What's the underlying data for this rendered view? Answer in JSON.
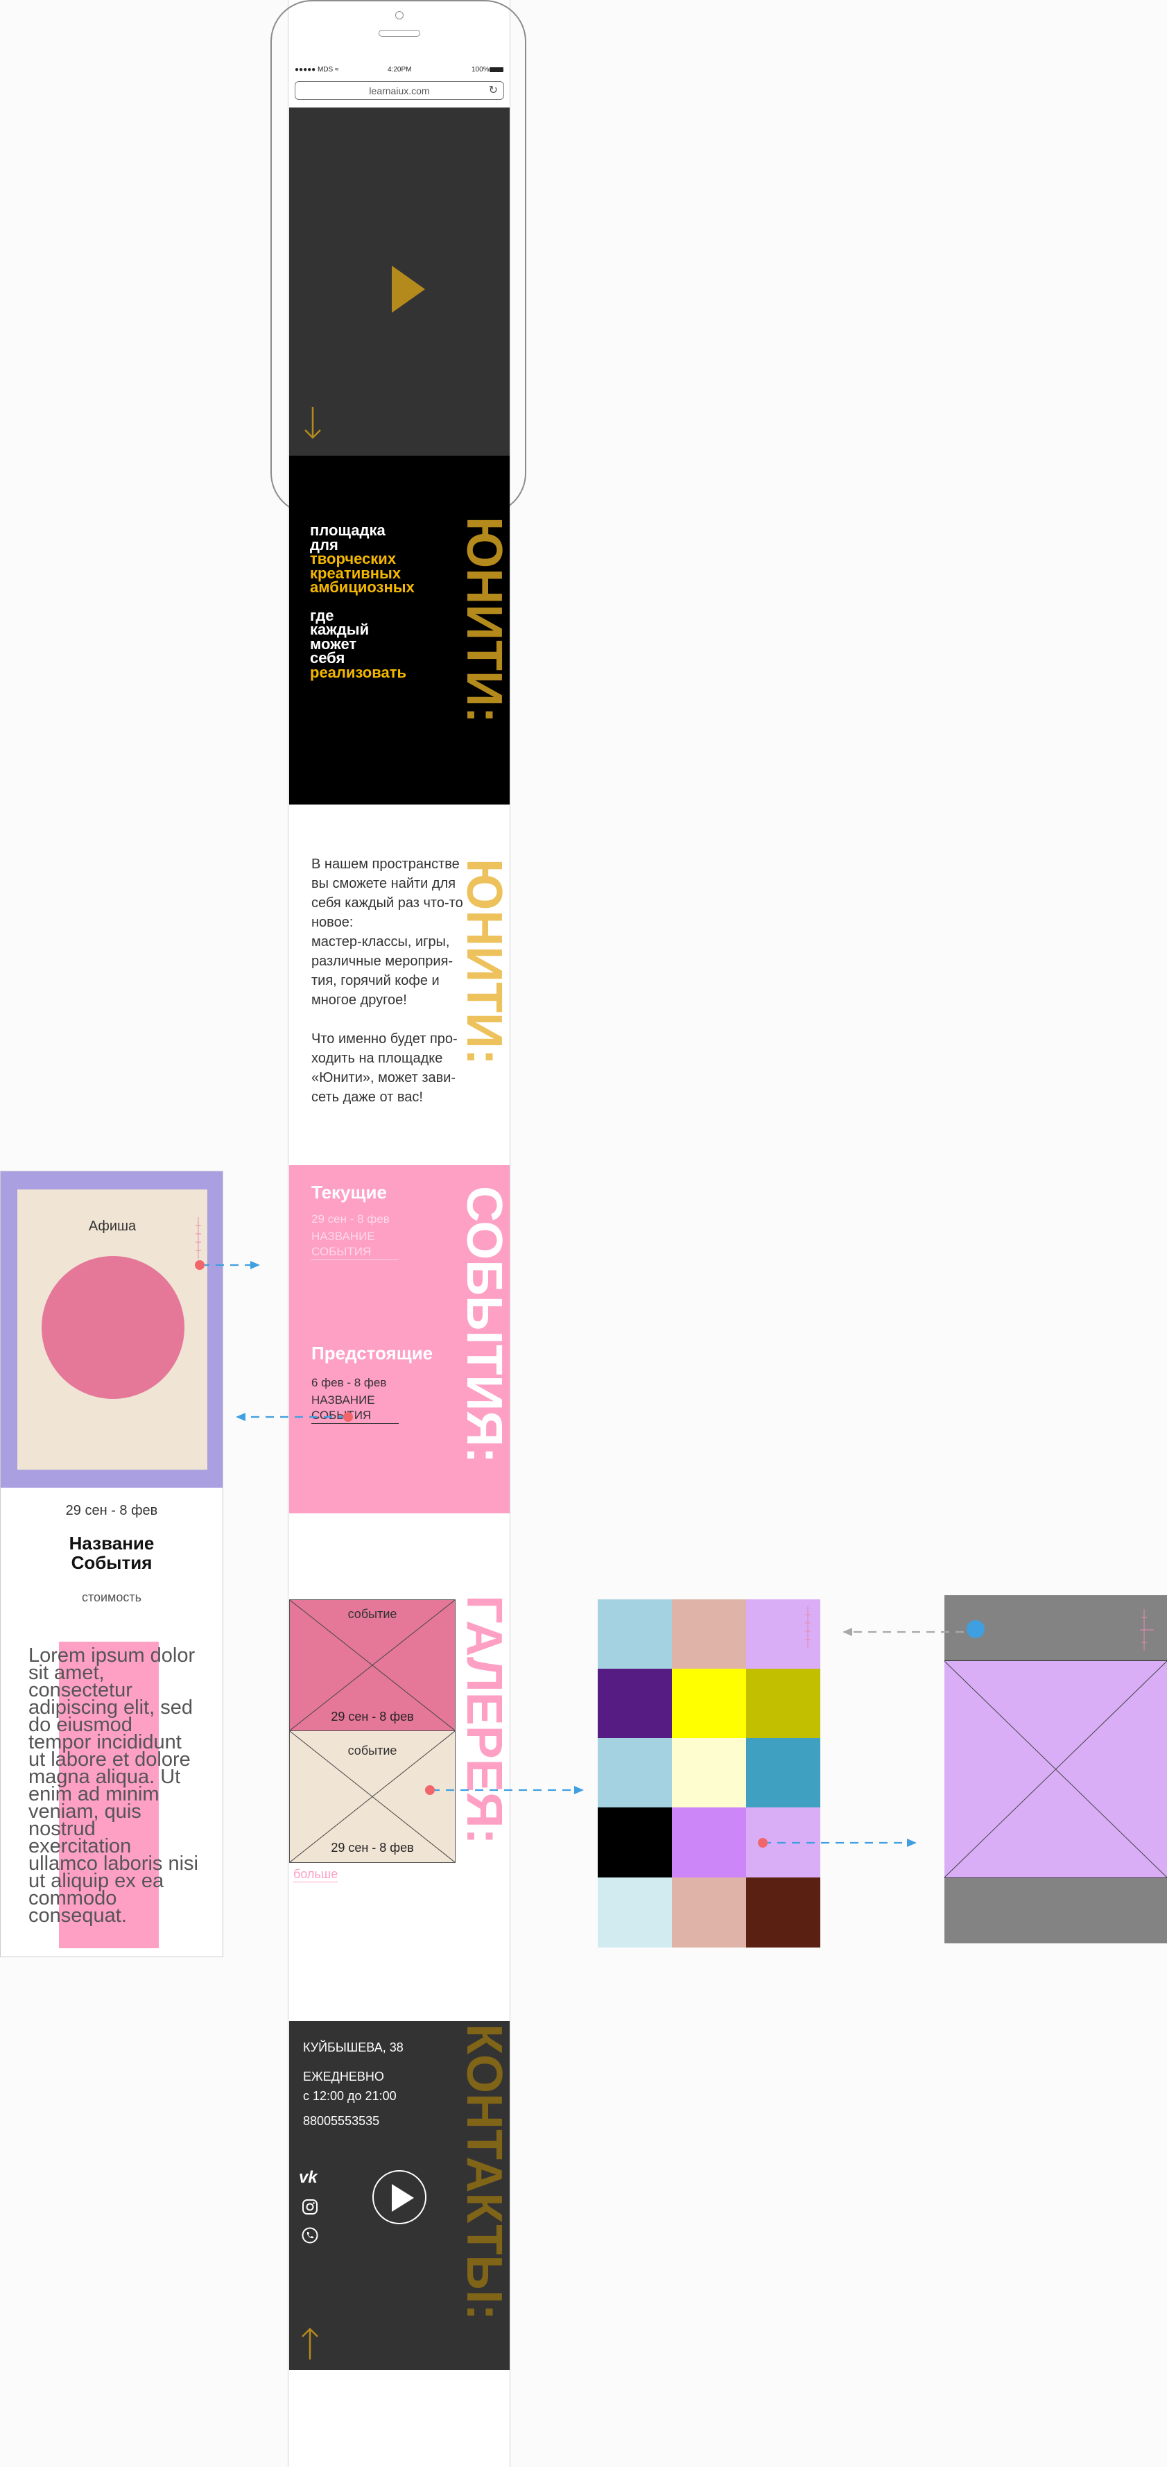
{
  "status_bar": {
    "carrier": "●●●●● MDS ≈",
    "time": "4:20PM",
    "battery": "100%"
  },
  "browser": {
    "url": "learnaiux.com"
  },
  "hero": {
    "scroll_down": "↓"
  },
  "intro": {
    "line1": "площадка",
    "line2": "для",
    "highlight1": "творческих",
    "highlight2": "креативных",
    "highlight3": "амбициозных",
    "line3": "где",
    "line4": "каждый",
    "line5": "может",
    "line6": "себя",
    "highlight4": "реализовать",
    "vertical": "ЮНИТИ:"
  },
  "about": {
    "p1": [
      "В нашем пространстве",
      "вы сможете найти для",
      "себя каждый раз что-то",
      "новое:",
      "мастер-классы, игры,",
      "различные мероприя-",
      "тия, горячий кофе и",
      "многое другое!"
    ],
    "p2": [
      "Что именно будет про-",
      "ходить на площадке",
      "«Юнити», может зави-",
      "сеть даже от вас!"
    ],
    "vertical": "ЮНИТИ:"
  },
  "events": {
    "vertical": "СОБЫТИЯ:",
    "current_title": "Текущие",
    "current_date": "29 сен - 8 фев",
    "current_name1": "НАЗВАНИЕ",
    "current_name2": "СОБЫТИЯ",
    "upcoming_title": "Предстоящие",
    "upcoming_date": "6 фев - 8 фев",
    "upcoming_name1": "НАЗВАНИЕ",
    "upcoming_name2": "СОБЫТИЯ"
  },
  "event_card": {
    "poster_label": "Афиша",
    "date": "29 сен - 8 фев",
    "title1": "Название",
    "title2": "События",
    "price": "стоимость",
    "lorem": "Lorem ipsum dolor sit amet, consectetur adipiscing elit, sed do eiusmod tempor incididunt ut labore et dolore magna aliqua. Ut enim ad minim veniam, quis nostrud exercitation ullamco laboris nisi ut aliquip ex ea commodo consequat."
  },
  "gallery": {
    "vertical": "ГАЛЕРЕЯ:",
    "item1_label": "событие",
    "item1_date": "29 сен - 8 фев",
    "item2_label": "событие",
    "item2_date": "29 сен - 8 фев",
    "more": "больше",
    "swatches": [
      "#a5d2e0",
      "#e0b3a8",
      "#d9aef7",
      "#561c84",
      "#ffff00",
      "#c2be00",
      "#a5d2e0",
      "#fdfdcf",
      "#40a0c2",
      "#000000",
      "#cc86f8",
      "#d9aef7",
      "#d2ebf1",
      "#e0b3a8",
      "#5a2012"
    ]
  },
  "contacts": {
    "vertical": "КОНТАКТЫ:",
    "address": "КУЙБЫШЕВА, 38",
    "schedule1": "ЕЖЕДНЕВНО",
    "schedule2": "с 12:00  до 21:00",
    "phone": "88005553535",
    "scroll_up": "↑"
  },
  "colors": {
    "accent_gold": "#b58a1d",
    "yellow": "#f5b800",
    "pink": "#fe9fc4",
    "dark": "#333333",
    "purple": "#aa9fe1",
    "beige": "#f0e4d4",
    "circle": "#e57898",
    "arrow_blue": "#3f9fe0",
    "dot_red": "#f0666a"
  }
}
